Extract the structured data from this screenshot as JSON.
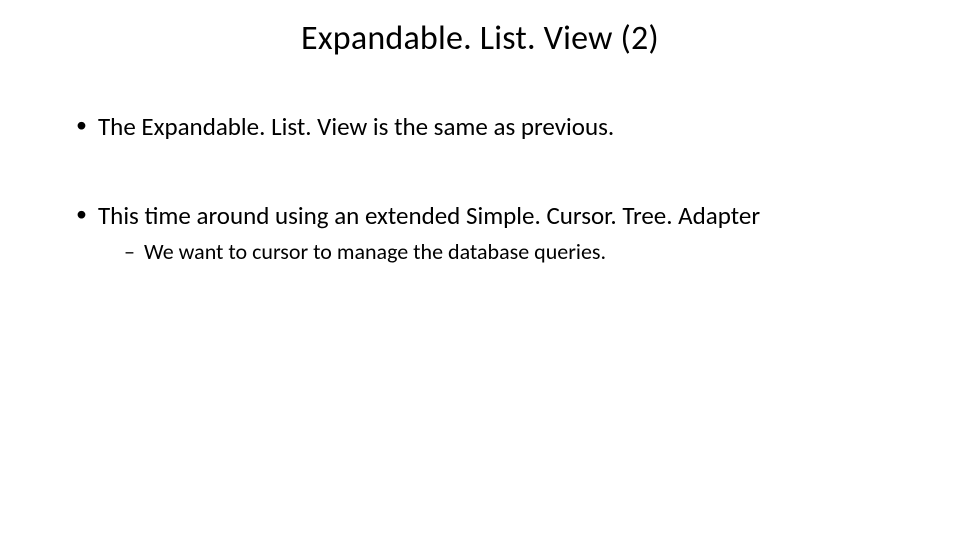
{
  "slide": {
    "title": "Expandable. List. View (2)",
    "bullets": [
      {
        "text": "The Expandable. List. View is the same as previous."
      },
      {
        "text": "This time around using an extended Simple. Cursor. Tree. Adapter",
        "sub": [
          "We want to cursor to manage the database queries."
        ]
      }
    ]
  }
}
